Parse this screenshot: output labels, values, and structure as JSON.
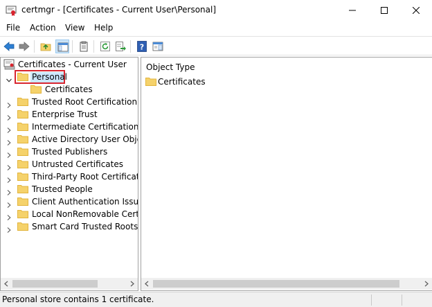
{
  "window": {
    "title": "certmgr - [Certificates - Current User\\Personal]"
  },
  "menu": [
    "File",
    "Action",
    "View",
    "Help"
  ],
  "toolbar": {
    "buttons": [
      "back-arrow-icon",
      "forward-arrow-icon",
      "up-folder-icon",
      "show-hide-tree-icon",
      "properties-icon",
      "refresh-icon",
      "export-list-icon",
      "help-icon",
      "show-action-pane-icon"
    ]
  },
  "tree": {
    "root": "Certificates - Current User",
    "personal": "Personal",
    "personal_child": "Certificates",
    "items": [
      "Trusted Root Certification Au",
      "Enterprise Trust",
      "Intermediate Certification Au",
      "Active Directory User Object",
      "Trusted Publishers",
      "Untrusted Certificates",
      "Third-Party Root Certification",
      "Trusted People",
      "Client Authentication Issuers",
      "Local NonRemovable Certific",
      "Smart Card Trusted Roots"
    ]
  },
  "list": {
    "column_header": "Object Type",
    "rows": [
      "Certificates"
    ]
  },
  "status": {
    "text": "Personal store contains 1 certificate."
  },
  "colors": {
    "folder": "#f5d26b",
    "folder_dark": "#e2b43d",
    "highlight_box": "#d8252f",
    "selection": "#cce8ff"
  }
}
